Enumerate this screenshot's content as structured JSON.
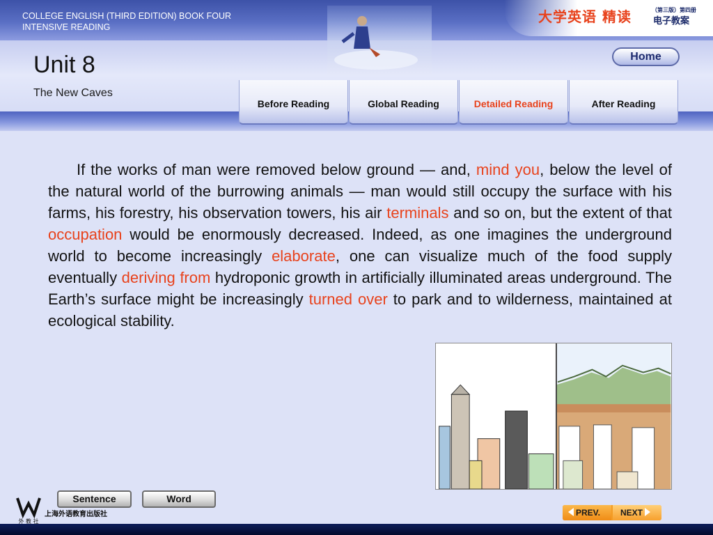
{
  "header": {
    "course_title": "COLLEGE ENGLISH (THIRD EDITION) BOOK FOUR INTENSIVE READING",
    "cn_title": "大学英语 精读",
    "cn_edition": "（第三版）第四册",
    "cn_subtitle": "电子教案",
    "home_label": "Home",
    "unit_title": "Unit 8",
    "unit_subtitle": "The New Caves"
  },
  "tabs": [
    {
      "label": "Before Reading",
      "active": false
    },
    {
      "label": "Global Reading",
      "active": false
    },
    {
      "label": "Detailed Reading",
      "active": true
    },
    {
      "label": "After Reading",
      "active": false
    }
  ],
  "passage": {
    "segments": [
      {
        "text": "If the works of man were removed below ground — and, ",
        "highlight": false
      },
      {
        "text": "mind you",
        "highlight": true
      },
      {
        "text": ", below the level of the natural world of the burrowing animals — man would still occupy the surface with his farms, his forestry, his observation towers, his air ",
        "highlight": false
      },
      {
        "text": "terminals",
        "highlight": true
      },
      {
        "text": " and so on, but the extent of that ",
        "highlight": false
      },
      {
        "text": "occupation",
        "highlight": true
      },
      {
        "text": " would be enormously decreased. Indeed, as one imagines the underground world to become increasingly ",
        "highlight": false
      },
      {
        "text": "elaborate",
        "highlight": true
      },
      {
        "text": ", one can visualize much of the food supply eventually ",
        "highlight": false
      },
      {
        "text": "deriving from",
        "highlight": true
      },
      {
        "text": " hydroponic growth in artificially illuminated areas underground. The Earth’s surface might be increasingly ",
        "highlight": false
      },
      {
        "text": "turned over",
        "highlight": true
      },
      {
        "text": " to park and to wilderness, maintained at ecological stability.",
        "highlight": false
      }
    ]
  },
  "buttons": {
    "sentence_label": "Sentence",
    "word_label": "Word"
  },
  "footer": {
    "publisher": "上海外语教育出版社",
    "logo_caption": "外 教 社",
    "prev_label": "PREV.",
    "next_label": "NEXT"
  },
  "colors": {
    "highlight": "#e8421c",
    "header_blue": "#3d52a8",
    "background": "#dde2f7",
    "nav_orange": "#f39c24"
  }
}
